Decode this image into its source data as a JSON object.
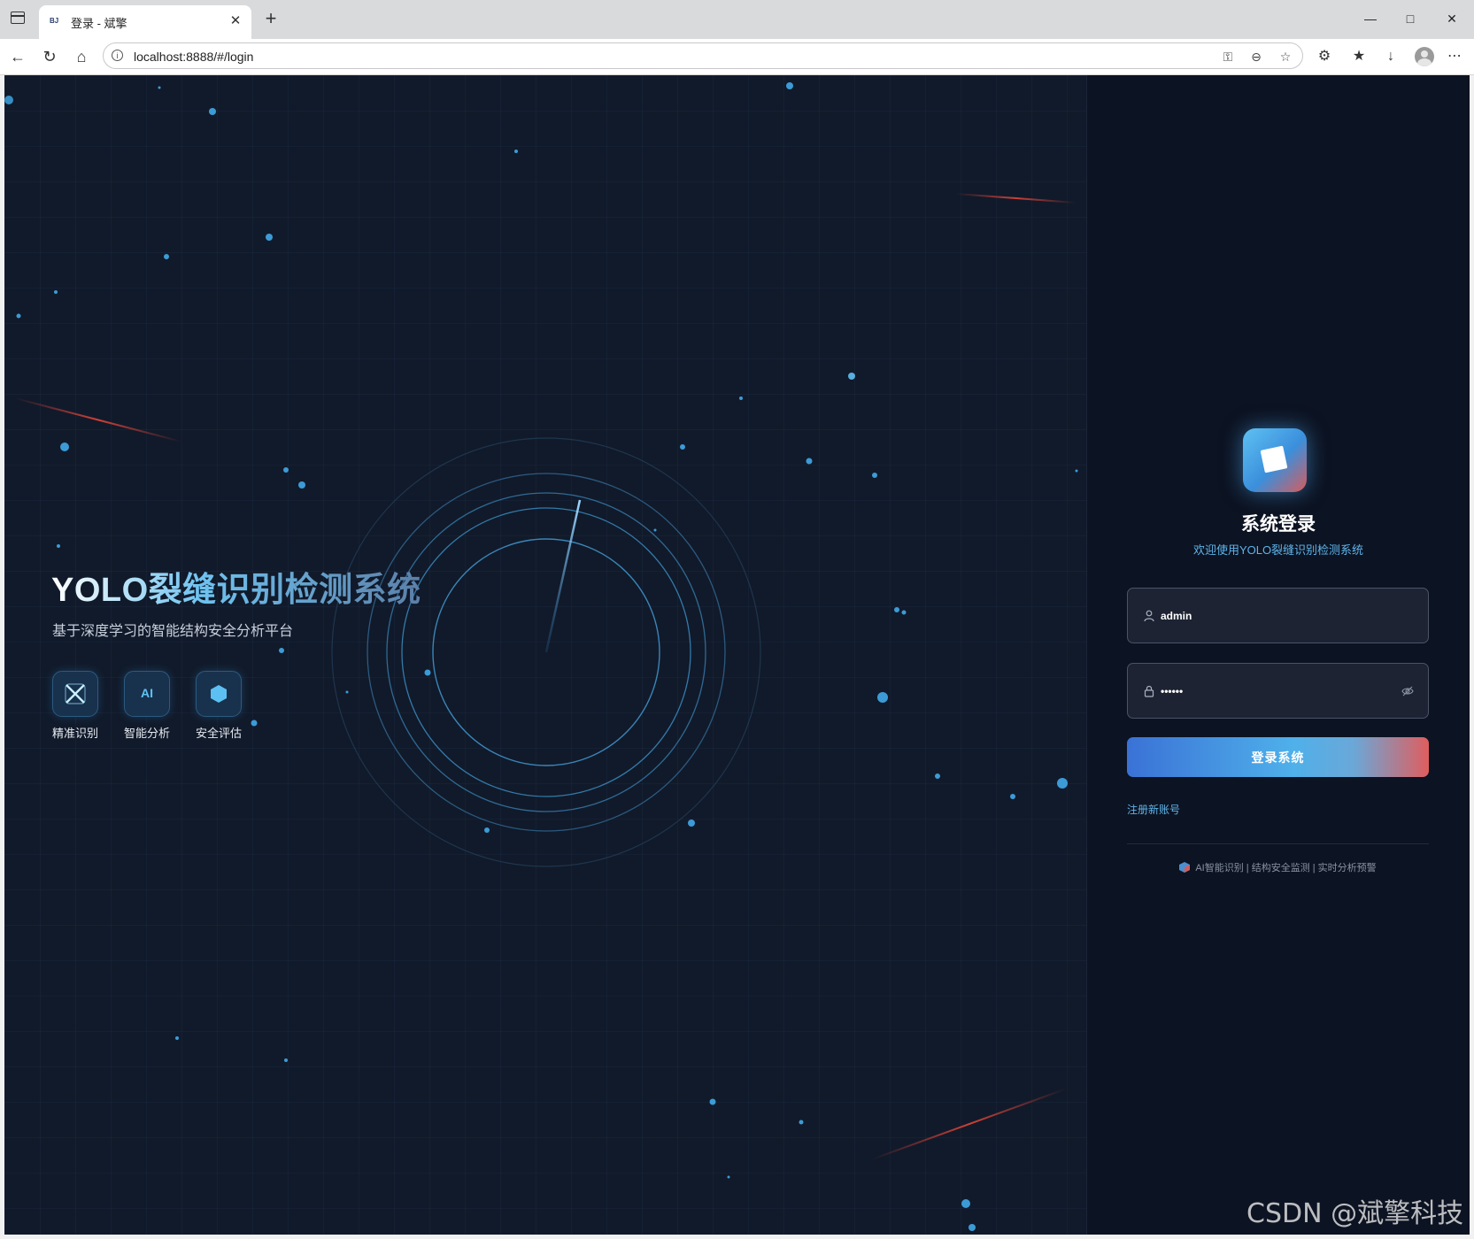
{
  "browser": {
    "tab_title": "登录 - 斌擎",
    "favicon_text": "BJ",
    "url": "localhost:8888/#/login",
    "new_tab_symbol": "+",
    "close_symbol": "✕"
  },
  "hero": {
    "title": "YOLO裂缝识别检测系统",
    "subtitle": "基于深度学习的智能结构安全分析平台",
    "features": [
      {
        "label": "精准识别",
        "icon": "precision-x-icon"
      },
      {
        "label": "智能分析",
        "icon": "ai-icon",
        "icon_text": "AI"
      },
      {
        "label": "安全评估",
        "icon": "hexagon-shield-icon"
      }
    ]
  },
  "login": {
    "title": "系统登录",
    "subtitle": "欢迎使用YOLO裂缝识别检测系统",
    "username_value": "admin",
    "password_value": "••••••",
    "submit_label": "登录系统",
    "register_label": "注册新账号",
    "footer_text": "AI智能识别 | 结构安全监测 | 实时分析预警"
  },
  "watermark": "CSDN @斌擎科技",
  "colors": {
    "accent_blue": "#5fb4ea",
    "accent_red": "#df5e5e",
    "page_bg": "#111a2a",
    "panel_bg": "#0c1322"
  }
}
